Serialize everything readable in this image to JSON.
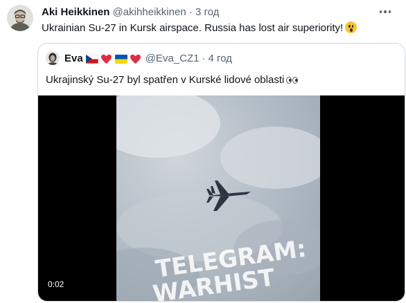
{
  "tweet": {
    "author_name": "Aki Heikkinen",
    "author_handle": "@akihheikkinen",
    "separator": "·",
    "time": "3 год",
    "text": "Ukrainian Su-27 in Kursk airspace. Russia has lost air superiority!",
    "emoji": "astonished-face-emoji"
  },
  "quote": {
    "author_name": "Eva",
    "author_handle": "@Eva_CZ1",
    "separator": "·",
    "time": "4 год",
    "name_emojis": [
      "czech-flag",
      "red-heart",
      "ukraine-flag",
      "red-heart"
    ],
    "text": "Ukrajinský Su-27 byl spatřen v  Kurské lidové oblasti",
    "text_emoji": "eyes-emoji"
  },
  "video": {
    "duration": "0:02",
    "watermark": "TELEGRAM:",
    "watermark_cut": "WARHIST",
    "colors": {
      "letterbox": "#000000",
      "sky": "#b5bec7"
    }
  },
  "colors": {
    "text_primary": "#0f1419",
    "text_secondary": "#536471",
    "border": "#cfd9de"
  }
}
